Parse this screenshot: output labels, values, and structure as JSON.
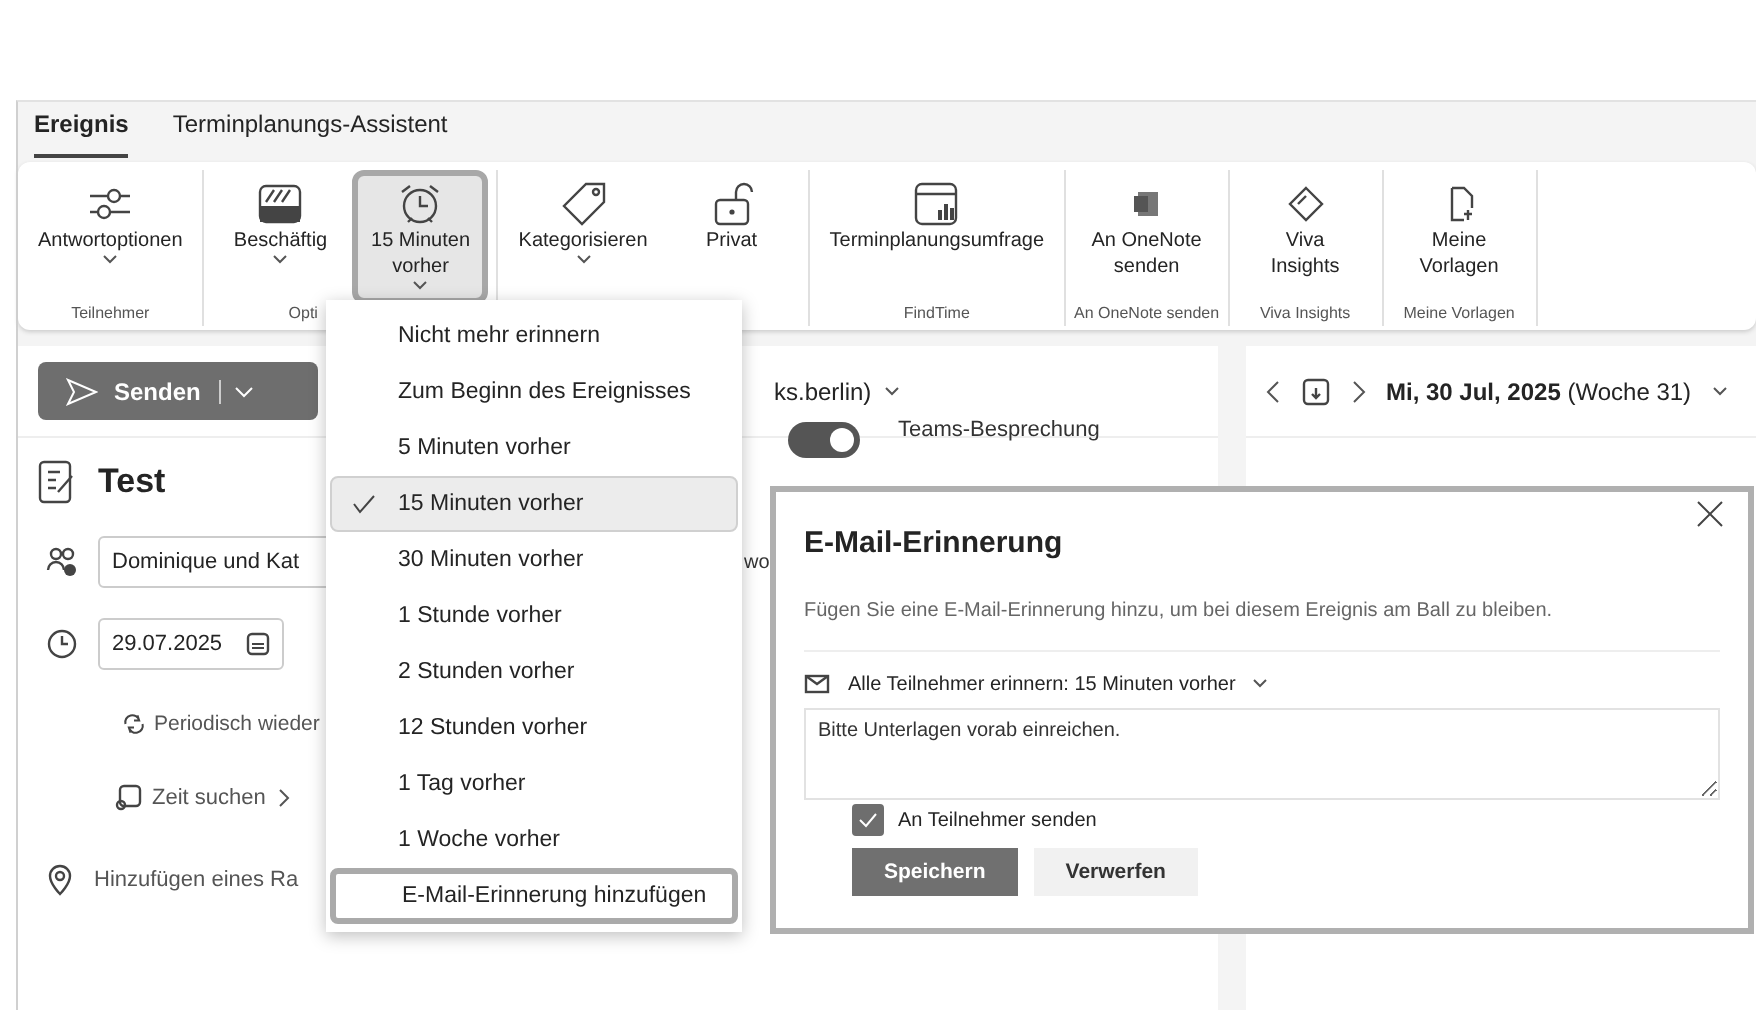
{
  "tabs": [
    {
      "label": "Ereignis",
      "selected": true
    },
    {
      "label": "Terminplanungs-Assistent",
      "selected": false
    }
  ],
  "ribbon": [
    {
      "label": "Teilnehmer",
      "buttons": [
        {
          "label": "Antwortoptionen",
          "kind": "sliders",
          "dropdown": true,
          "selected": false
        }
      ]
    },
    {
      "label": "Opti",
      "buttons": [
        {
          "label": "Beschäftig",
          "kind": "busy",
          "dropdown": true,
          "selected": false
        },
        {
          "label": "15 Minuten vorher",
          "kind": "alarm",
          "dropdown": true,
          "selected": true
        }
      ]
    },
    {
      "buttons": [
        {
          "label": "Kategorisieren",
          "kind": "tag",
          "dropdown": true,
          "selected": false
        },
        {
          "label": "Privat",
          "kind": "lock",
          "dropdown": false,
          "selected": false
        }
      ]
    },
    {
      "label": "FindTime",
      "buttons": [
        {
          "label": "Terminplanungsumfrage",
          "kind": "poll",
          "dropdown": false,
          "selected": false
        }
      ]
    },
    {
      "label": "An OneNote senden",
      "buttons": [
        {
          "label": "An OneNote senden",
          "kind": "onenote",
          "dropdown": false,
          "selected": false
        }
      ]
    },
    {
      "label": "Viva Insights",
      "buttons": [
        {
          "label": "Viva Insights",
          "kind": "viva",
          "dropdown": false,
          "selected": false
        }
      ]
    },
    {
      "label": "Meine Vorlagen",
      "buttons": [
        {
          "label": "Meine Vorlagen",
          "kind": "template",
          "dropdown": false,
          "selected": false
        }
      ]
    }
  ],
  "form": {
    "send": "Senden",
    "from": "ks.berlin)",
    "title": "Test",
    "teams_label": "Teams-Besprechung",
    "teams_on": true,
    "attendees": "Dominique und Kat",
    "attendees_tail": "wo",
    "date": "29.07.2025",
    "recurrence": "Periodisch wieder",
    "find_time": "Zeit suchen",
    "location": "Hinzufügen eines Ra"
  },
  "calendar": {
    "date": "Mi, 30 Jul, 2025",
    "week": "(Woche 31)"
  },
  "reminder_menu": [
    {
      "label": "Nicht mehr erinnern",
      "kind": "option",
      "selected": false
    },
    {
      "label": "Zum Beginn des Ereignisses",
      "kind": "option",
      "selected": false
    },
    {
      "label": "5 Minuten vorher",
      "kind": "option",
      "selected": false
    },
    {
      "label": "15 Minuten vorher",
      "kind": "option",
      "selected": true
    },
    {
      "label": "30 Minuten vorher",
      "kind": "option",
      "selected": false
    },
    {
      "label": "1 Stunde vorher",
      "kind": "option",
      "selected": false
    },
    {
      "label": "2 Stunden vorher",
      "kind": "option",
      "selected": false
    },
    {
      "label": "12 Stunden vorher",
      "kind": "option",
      "selected": false
    },
    {
      "label": "1 Tag vorher",
      "kind": "option",
      "selected": false
    },
    {
      "label": "1 Woche vorher",
      "kind": "option",
      "selected": false
    },
    {
      "label": "E-Mail-Erinnerung hinzufügen",
      "kind": "action",
      "selected": false
    }
  ],
  "dialog": {
    "title": "E-Mail-Erinnerung",
    "description": "Fügen Sie eine E-Mail-Erinnerung hinzu, um bei diesem Ereignis am Ball zu bleiben.",
    "remind": "Alle Teilnehmer erinnern: 15 Minuten vorher",
    "message": "Bitte Unterlagen vorab einreichen.",
    "send_to_attendees": {
      "label": "An Teilnehmer senden",
      "checked": true
    },
    "buttons": [
      {
        "label": "Speichern",
        "kind": "primary"
      },
      {
        "label": "Verwerfen",
        "kind": "secondary"
      }
    ]
  }
}
